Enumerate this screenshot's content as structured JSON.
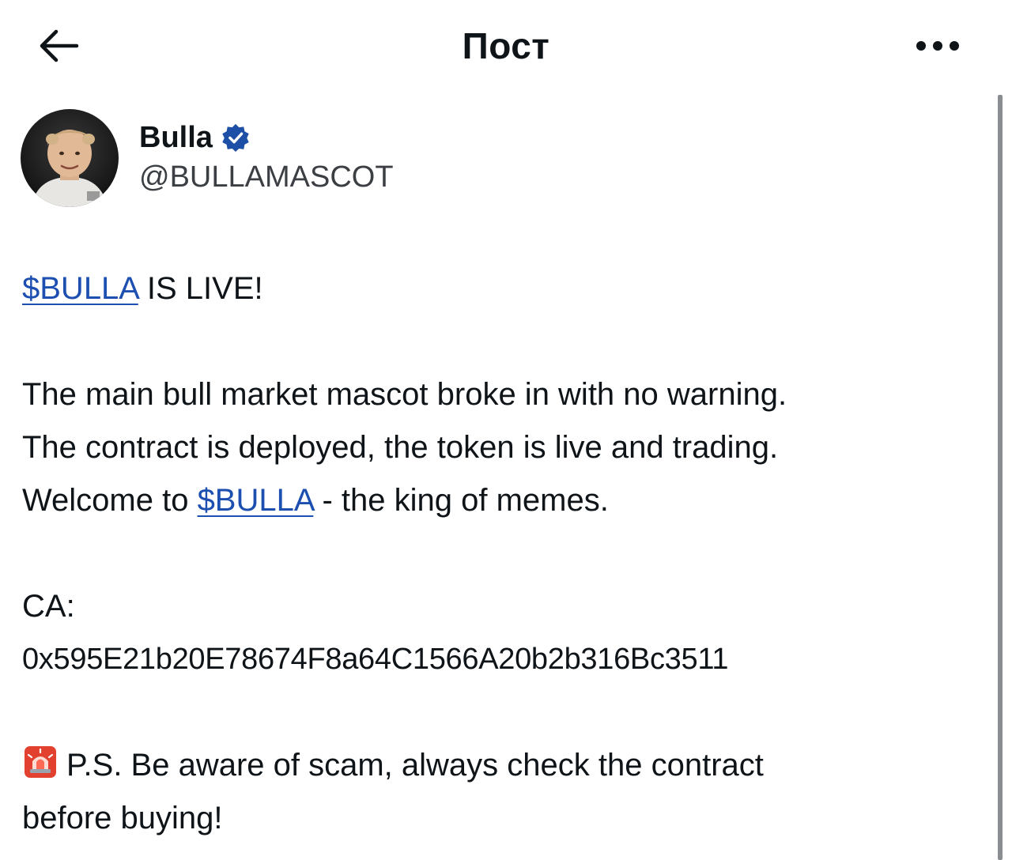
{
  "header": {
    "title": "Пост",
    "back_icon": "arrow-left-icon",
    "more_icon": "more-horizontal-icon"
  },
  "author": {
    "display_name": "Bulla",
    "handle": "@BULLAMASCOT",
    "verified_icon": "verified-badge-icon",
    "verified_color": "#1d4fa6"
  },
  "post": {
    "line1_cashtag": "$BULLA",
    "line1_rest": " IS LIVE!",
    "para_line1": "The main bull market mascot broke in with no warning.",
    "para_line2": "The contract is deployed, the token is live and trading.",
    "para_line3_prefix": "Welcome to ",
    "para_line3_cashtag": "$BULLA",
    "para_line3_suffix": " - the king of memes.",
    "ca_label": "CA:",
    "ca_value": "0x595E21b20E78674F8a64C1566A20b2b316Bc3511",
    "alarm_icon": "police-light-emoji-icon",
    "ps_line1": "P.S. Be aware of scam, always check the contract",
    "ps_line2": "before buying!"
  },
  "colors": {
    "link": "#1c4fb0",
    "text": "#0f1419",
    "secondary": "#3b3f44"
  }
}
